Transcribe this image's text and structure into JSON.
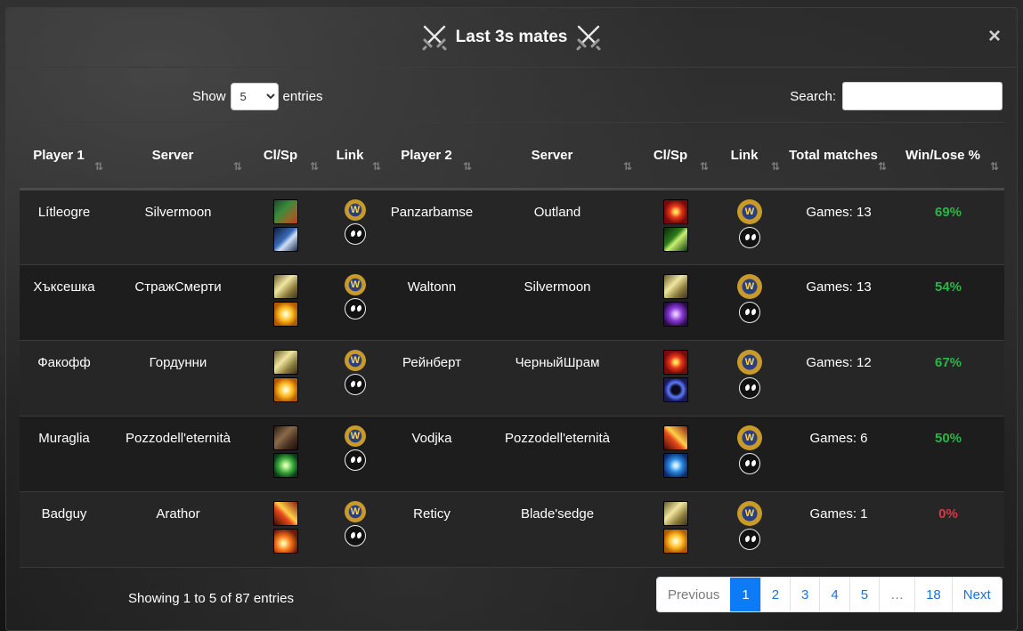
{
  "modal": {
    "title": "Last 3s mates",
    "close_symbol": "×"
  },
  "length_control": {
    "before": "Show",
    "value": "5",
    "after": "entries"
  },
  "search": {
    "label": "Search:",
    "value": ""
  },
  "columns": [
    {
      "label": "Player 1",
      "sort": "⇅"
    },
    {
      "label": "Server",
      "sort": "⇅"
    },
    {
      "label": "Cl/Sp",
      "sort": "⇅"
    },
    {
      "label": "Link",
      "sort": "⇅"
    },
    {
      "label": "Player 2",
      "sort": "⇅"
    },
    {
      "label": "Server",
      "sort": "⇅"
    },
    {
      "label": "Cl/Sp",
      "sort": "⇅"
    },
    {
      "label": "Link",
      "sort": "⇅"
    },
    {
      "label": "Total matches",
      "sort": "⇅"
    },
    {
      "label": "Win/Lose %",
      "sort": "⇅"
    }
  ],
  "link_icons": {
    "armory": "wow-logo-icon",
    "check_pvp": "eyes-icon",
    "armory_glyph": "W"
  },
  "rows": [
    {
      "player1": "Lítleogre",
      "server1": "Silvermoon",
      "p1_icons": [
        "shaman-enhancement",
        "death-knight-frost"
      ],
      "player2": "Panzarbamse",
      "server2": "Outland",
      "p2_icons": [
        "warrior-arms",
        "druid-feral"
      ],
      "matches": "Games: 13",
      "winrate": "69%",
      "win_color": "#28b745"
    },
    {
      "player1": "Хъксешка",
      "server1": "СтражСмерти",
      "p1_icons": [
        "paladin-holy",
        "priest-holy"
      ],
      "player2": "Waltonn",
      "server2": "Silvermoon",
      "p2_icons": [
        "paladin-holy",
        "warlock-affliction"
      ],
      "matches": "Games: 13",
      "winrate": "54%",
      "win_color": "#28b745"
    },
    {
      "player1": "Факофф",
      "server1": "Гордунни",
      "p1_icons": [
        "paladin-holy",
        "priest-holy"
      ],
      "player2": "Рейнберт",
      "server2": "ЧерныйШрам",
      "p2_icons": [
        "warrior-arms",
        "priest-shadow"
      ],
      "matches": "Games: 12",
      "winrate": "67%",
      "win_color": "#28b745"
    },
    {
      "player1": "Muraglia",
      "server1": "Pozzodell'eternità",
      "p1_icons": [
        "druid-balance",
        "druid-restoration"
      ],
      "player2": "Vodjka",
      "server2": "Pozzodell'eternità",
      "p2_icons": [
        "mage-fire",
        "shaman-restoration"
      ],
      "matches": "Games: 6",
      "winrate": "50%",
      "win_color": "#28b745"
    },
    {
      "player1": "Badguy",
      "server1": "Arathor",
      "p1_icons": [
        "mage-fire",
        "mage-fire-blast"
      ],
      "player2": "Reticy",
      "server2": "Blade'sedge",
      "p2_icons": [
        "paladin-holy",
        "priest-holy"
      ],
      "matches": "Games: 1",
      "winrate": "0%",
      "win_color": "#dc3545"
    }
  ],
  "footer": {
    "info": "Showing 1 to 5 of 87 entries"
  },
  "pagination": [
    "Previous",
    "1",
    "2",
    "3",
    "4",
    "5",
    "…",
    "18",
    "Next"
  ],
  "colors": {
    "accent": "#0d7bf5",
    "win": "#28b745",
    "lose": "#dc3545"
  }
}
